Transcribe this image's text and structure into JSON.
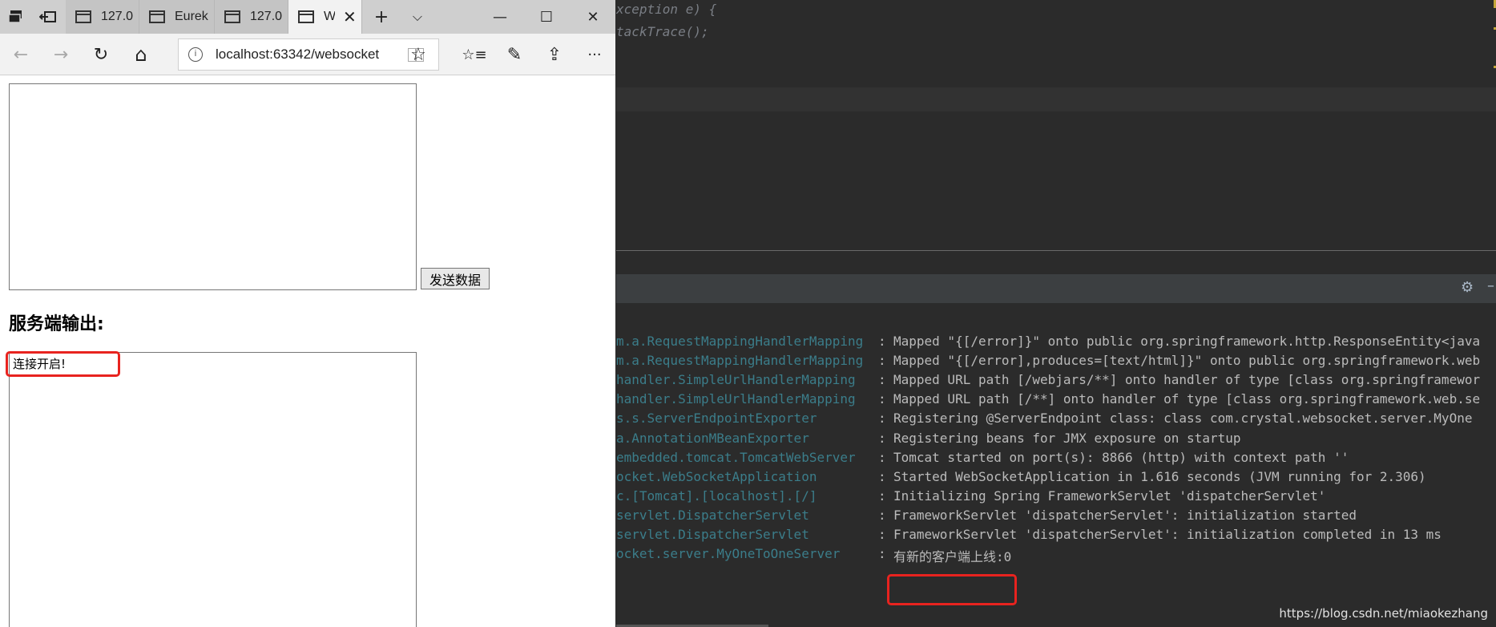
{
  "browser": {
    "tabs": [
      {
        "label": "127.0"
      },
      {
        "label": "Eurek"
      },
      {
        "label": "127.0"
      },
      {
        "label": "W"
      }
    ],
    "new_tab": "+",
    "tab_list": "⌵",
    "window": {
      "minimize": "—",
      "maximize": "☐",
      "close": "✕"
    },
    "nav": {
      "back": "←",
      "forward": "→",
      "refresh": "↻",
      "home": "⌂",
      "favorites": "☆",
      "favorites_bar": "☆≡",
      "pen": "✎",
      "share": "⇪",
      "more": "···"
    },
    "address": {
      "url": "localhost:63342/websocket",
      "info": "i"
    },
    "page": {
      "send_button": "发送数据",
      "server_heading": "服务端输出:",
      "server_output": "连接开启!"
    }
  },
  "ide": {
    "code_lines": [
      "xception e) {",
      "tackTrace();"
    ],
    "console": [
      {
        "source": "m.a.RequestMappingHandlerMapping",
        "message": "Mapped \"{[/error]}\" onto public org.springframework.http.ResponseEntity<java"
      },
      {
        "source": "m.a.RequestMappingHandlerMapping",
        "message": "Mapped \"{[/error],produces=[text/html]}\" onto public org.springframework.web"
      },
      {
        "source": "handler.SimpleUrlHandlerMapping",
        "message": "Mapped URL path [/webjars/**] onto handler of type [class org.springframewor"
      },
      {
        "source": "handler.SimpleUrlHandlerMapping",
        "message": "Mapped URL path [/**] onto handler of type [class org.springframework.web.se"
      },
      {
        "source": "s.s.ServerEndpointExporter",
        "message": "Registering @ServerEndpoint class: class com.crystal.websocket.server.MyOne"
      },
      {
        "source": "a.AnnotationMBeanExporter",
        "message": "Registering beans for JMX exposure on startup"
      },
      {
        "source": "embedded.tomcat.TomcatWebServer",
        "message": "Tomcat started on port(s): 8866 (http) with context path ''"
      },
      {
        "source": "ocket.WebSocketApplication",
        "message": "Started WebSocketApplication in 1.616 seconds (JVM running for 2.306)"
      },
      {
        "source": "c.[Tomcat].[localhost].[/]",
        "message": "Initializing Spring FrameworkServlet 'dispatcherServlet'"
      },
      {
        "source": "servlet.DispatcherServlet",
        "message": "FrameworkServlet 'dispatcherServlet': initialization started"
      },
      {
        "source": "servlet.DispatcherServlet",
        "message": "FrameworkServlet 'dispatcherServlet': initialization completed in 13 ms"
      },
      {
        "source": "ocket.server.MyOneToOneServer",
        "message": "有新的客户端上线:0"
      }
    ],
    "separator": ":",
    "settings_icon": "⚙",
    "hide_icon": "–"
  },
  "watermark": "https://blog.csdn.net/miaokezhang",
  "colors": {
    "highlight": "#e8231f",
    "console_source": "#3b7d8a",
    "console_text": "#bbbbbb"
  }
}
